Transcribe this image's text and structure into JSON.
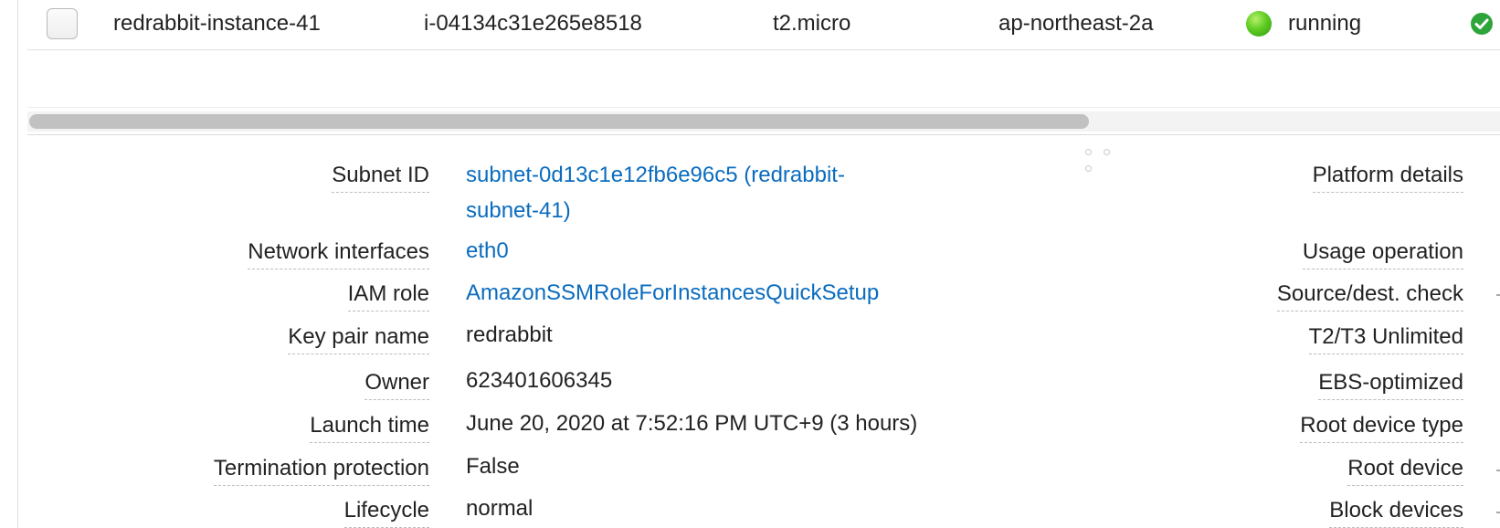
{
  "instance_row": {
    "name": "redrabbit-instance-41",
    "instance_id": "i-04134c31e265e8518",
    "instance_type": "t2.micro",
    "availability_zone": "ap-northeast-2a",
    "state": "running",
    "state_color": "#4fc11f",
    "status_check_icon": "check-circle-icon"
  },
  "details_left": [
    {
      "label": "Subnet ID",
      "value_line1": "subnet-0d13c1e12fb6e96c5 (redrabbit-",
      "value_line2": "subnet-41)",
      "link": true
    },
    {
      "label": "Network interfaces",
      "value": "eth0",
      "link": true
    },
    {
      "label": "IAM role",
      "value": "AmazonSSMRoleForInstancesQuickSetup",
      "link": true
    },
    {
      "label": "Key pair name",
      "value": "redrabbit",
      "link": false
    },
    {
      "label": "Owner",
      "value": "623401606345",
      "link": false
    },
    {
      "label": "Launch time",
      "value": "June 20, 2020 at 7:52:16 PM UTC+9 (3 hours)",
      "link": false
    },
    {
      "label": "Termination protection",
      "value": "False",
      "link": false
    },
    {
      "label": "Lifecycle",
      "value": "normal",
      "link": false
    }
  ],
  "details_right": [
    {
      "label": "Platform details"
    },
    {
      "label": "Usage operation"
    },
    {
      "label": "Source/dest. check"
    },
    {
      "label": "T2/T3 Unlimited"
    },
    {
      "label": "EBS-optimized"
    },
    {
      "label": "Root device type"
    },
    {
      "label": "Root device"
    },
    {
      "label": "Block devices"
    }
  ],
  "colors": {
    "link": "#0a6cbf",
    "text": "#222222",
    "label_underline": "#bcbcbc"
  }
}
